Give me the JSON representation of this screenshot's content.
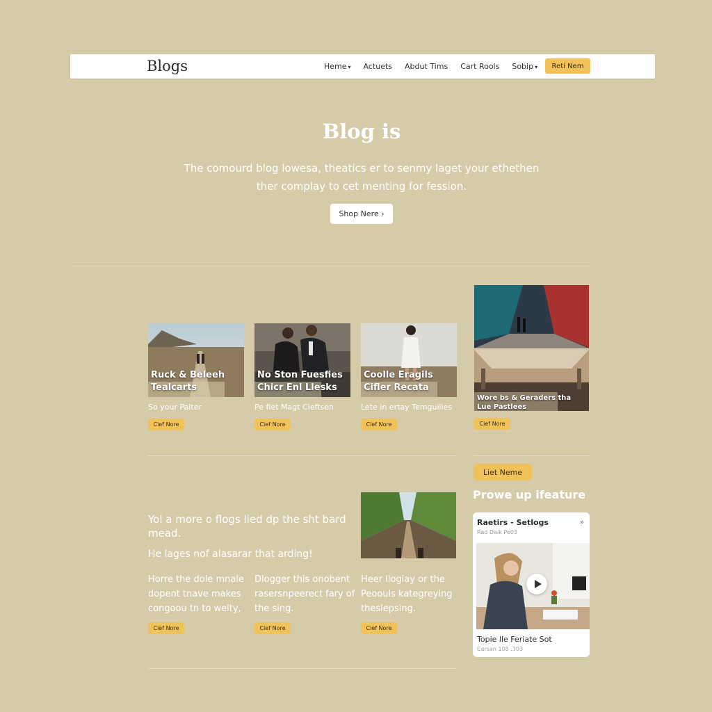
{
  "nav": {
    "logo": "Blogs",
    "links": [
      {
        "label": "Heme",
        "dropdown": true
      },
      {
        "label": "Actuets",
        "dropdown": false
      },
      {
        "label": "Abdut Tims",
        "dropdown": false
      },
      {
        "label": "Cart Rools",
        "dropdown": false
      },
      {
        "label": "Sobip",
        "dropdown": true
      }
    ],
    "cta": "Reti Nem"
  },
  "hero": {
    "title": "Blog is",
    "subtitle": "The comourd blog lowesa, theatics er to senmy laget your ethethen ther complay to cet menting for fession.",
    "button": "Shop Nere ›"
  },
  "cards": [
    {
      "caption": "Ruck & Beleeh Tealcarts",
      "desc": "So your Palter",
      "chip": "Cief Nore"
    },
    {
      "caption": "No Ston Fuesfies Chicr Enl Llesks",
      "desc": "Pe fiet Magt Cieftsen",
      "chip": "Cief Nore"
    },
    {
      "caption": "Coolle Eragils Cifler Recata",
      "desc": "Lete in ertay Temguilies",
      "chip": "Cief Nore"
    }
  ],
  "feature_card": {
    "caption": "Wore bs & Geraders tha Lue Pastlees",
    "chip": "Cief Nore"
  },
  "lower": {
    "heading": "Yol a more o flogs lied dp the sht bard mead.",
    "subheading": "He lages nof alasarar that arding!",
    "columns": [
      {
        "text": "Horre the dole mnale dopent tnave makes congoou tn to welty,",
        "chip": "Cief Nore"
      },
      {
        "text": "Dlogger this onobent rasersnpeerect fary of the sing.",
        "chip": "Cief Nore"
      },
      {
        "text": "Heer llogiay or the Peoouls kategreying theslepsing.",
        "chip": "Cief Nore"
      }
    ]
  },
  "sidebar": {
    "button": "Liet Neme",
    "heading": "Prowe up ifeature",
    "video": {
      "title": "Raetirs - Setlogs",
      "meta": "Rad Daik Pe03",
      "share": "»",
      "footer_title": "Topie lle Feriate Sot",
      "footer_meta": "Cersan 108 .303"
    }
  },
  "colors": {
    "background": "#d6cba9",
    "accent": "#f2c25a",
    "text": "#ffffff"
  }
}
